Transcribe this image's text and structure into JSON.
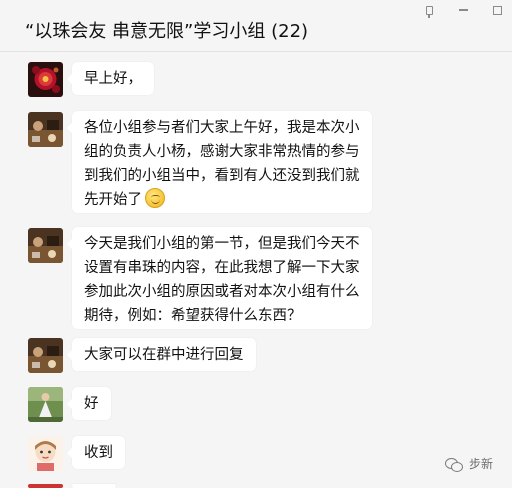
{
  "window": {
    "title": "“以珠会友 串意无限”学习小组 (22)",
    "pin_label": "pin",
    "min_label": "minimize",
    "max_label": "maximize"
  },
  "messages": [
    {
      "avatar": "red-flower-avatar",
      "lines": [
        "早上好，"
      ]
    },
    {
      "avatar": "brown-table-avatar",
      "lines": [
        "各位小组参与者们大家上午好，我是本次小",
        "组的负责人小杨，感谢大家非常热情的参与",
        "到我们的小组当中，看到有人还没到我们就",
        "先开始了"
      ],
      "emoji": "smile-emoji"
    },
    {
      "avatar": "brown-table-avatar",
      "lines": [
        "今天是我们小组的第一节，但是我们今天不",
        "设置有串珠的内容，在此我想了解一下大家",
        "参加此次小组的原因或者对本次小组有什么",
        "期待，例如：希望获得什么东西？"
      ]
    },
    {
      "avatar": "brown-table-avatar",
      "lines": [
        "大家可以在群中进行回复"
      ]
    },
    {
      "avatar": "green-dress-avatar",
      "lines": [
        "好"
      ]
    },
    {
      "avatar": "cartoon-girl-avatar",
      "lines": [
        "收到"
      ]
    }
  ],
  "watermark": {
    "text": "步新",
    "icon": "wechat-icon"
  },
  "colors": {
    "background": "#f5f5f5",
    "bubble": "#ffffff"
  }
}
